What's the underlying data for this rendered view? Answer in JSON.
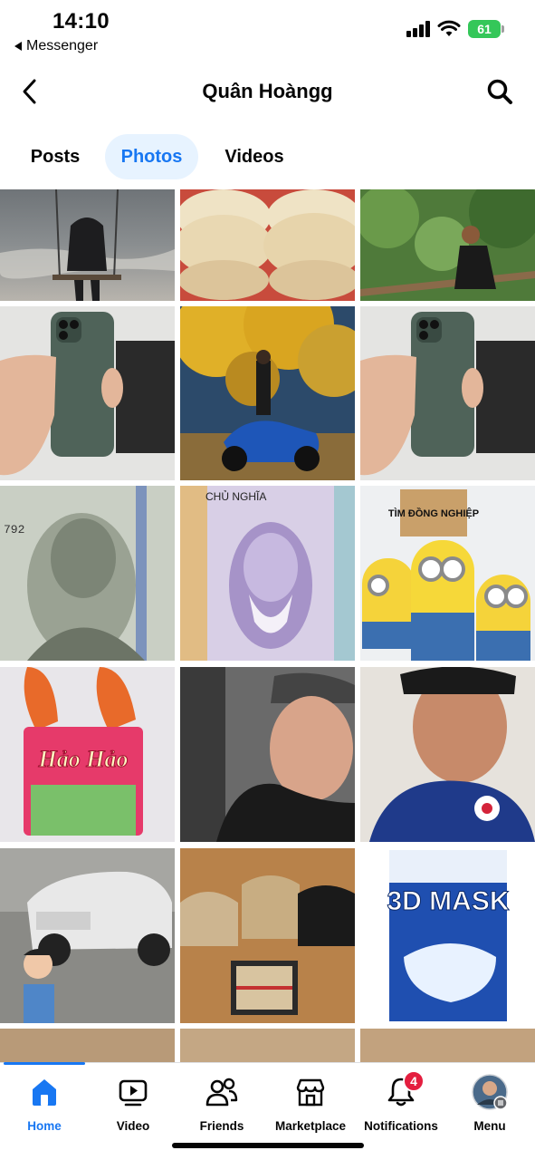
{
  "status_bar": {
    "time": "14:10",
    "back_app": "Messenger",
    "battery": "61"
  },
  "header": {
    "title": "Quân Hoàngg"
  },
  "tabs": [
    {
      "label": "Posts",
      "active": false
    },
    {
      "label": "Photos",
      "active": true
    },
    {
      "label": "Videos",
      "active": false
    }
  ],
  "photos": [
    {
      "name": "photo-person-on-swing-by-sea",
      "overlay_text": ""
    },
    {
      "name": "photo-rice-paper-stacks",
      "overlay_text": ""
    },
    {
      "name": "photo-man-sitting-in-forest",
      "overlay_text": ""
    },
    {
      "name": "photo-iphone-in-hand",
      "overlay_text": ""
    },
    {
      "name": "photo-man-on-motorbike-under-yellow-tree",
      "overlay_text": ""
    },
    {
      "name": "photo-iphone-in-hand-2",
      "overlay_text": ""
    },
    {
      "name": "photo-dollar-banknote",
      "overlay_text": "792"
    },
    {
      "name": "photo-vnd-banknote",
      "overlay_text": "CHỦ NGHĨA"
    },
    {
      "name": "photo-minions-sign",
      "overlay_text": "TÌM ĐỒNG NGHIỆP"
    },
    {
      "name": "photo-hao-hao-noodles-shrimp",
      "overlay_text": "Hảo Hảo"
    },
    {
      "name": "photo-selfie-black-cap",
      "overlay_text": ""
    },
    {
      "name": "photo-selfie-camo-shirt",
      "overlay_text": ""
    },
    {
      "name": "photo-mercedes-cartoon",
      "overlay_text": ""
    },
    {
      "name": "photo-gucci-caps-wallet",
      "overlay_text": ""
    },
    {
      "name": "photo-3d-mask-box",
      "overlay_text": "3D MASK"
    },
    {
      "name": "photo-partial-1",
      "overlay_text": ""
    },
    {
      "name": "photo-partial-2",
      "overlay_text": ""
    },
    {
      "name": "photo-partial-3",
      "overlay_text": ""
    }
  ],
  "bottom_nav": {
    "items": [
      {
        "label": "Home",
        "icon": "home-icon",
        "active": true
      },
      {
        "label": "Video",
        "icon": "video-icon",
        "active": false
      },
      {
        "label": "Friends",
        "icon": "friends-icon",
        "active": false
      },
      {
        "label": "Marketplace",
        "icon": "marketplace-icon",
        "active": false
      },
      {
        "label": "Notifications",
        "icon": "bell-icon",
        "active": false,
        "badge": "4"
      },
      {
        "label": "Menu",
        "icon": "avatar",
        "active": false
      }
    ]
  },
  "colors": {
    "accent": "#1877f2",
    "tab_active_bg": "#e7f3ff",
    "badge": "#e41e3f",
    "battery": "#34c759"
  }
}
